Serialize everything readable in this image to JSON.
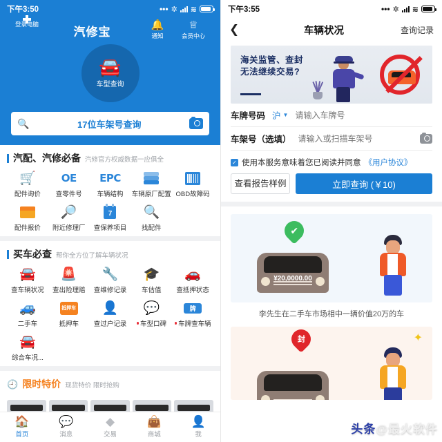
{
  "left": {
    "status": {
      "time": "下午3:50"
    },
    "hero": {
      "scan_label": "登录电脑",
      "app_title": "汽修宝",
      "notify_label": "通知",
      "member_label": "会员中心",
      "circle_label": "车型查询",
      "search_text": "17位车架号查询",
      "search_icon": "search-icon",
      "camera_icon": "camera-icon"
    },
    "section_parts": {
      "title": "汽配、汽修必备",
      "subtitle": "汽修官方权威数据一应俱全",
      "items": [
        {
          "label": "配件询价",
          "icon": "cart-icon"
        },
        {
          "label": "查零件号",
          "icon": "oe-text-icon"
        },
        {
          "label": "车辆结构",
          "icon": "epc-text-icon"
        },
        {
          "label": "车辆原厂配置",
          "icon": "layers-icon"
        },
        {
          "label": "OBD故障码",
          "icon": "barcode-icon"
        },
        {
          "label": "配件报价",
          "icon": "shop-icon"
        },
        {
          "label": "附近修理厂",
          "icon": "location-search-icon"
        },
        {
          "label": "查保养项目",
          "icon": "calendar-icon"
        },
        {
          "label": "找配件",
          "icon": "magnifier-icon"
        }
      ]
    },
    "section_buy": {
      "title": "买车必查",
      "subtitle": "帮你全方位了解车辆状况",
      "items": [
        {
          "label": "查车辆状况",
          "icon": "car-icon",
          "dot": false
        },
        {
          "label": "查出险理赔",
          "icon": "siren-icon",
          "dot": false
        },
        {
          "label": "查维修记录",
          "icon": "repair-icon",
          "dot": false
        },
        {
          "label": "车估值",
          "icon": "valuation-icon",
          "dot": false
        },
        {
          "label": "查抵押状态",
          "icon": "mortgage-car-icon",
          "dot": false
        },
        {
          "label": "二手车",
          "icon": "used-car-icon",
          "dot": false
        },
        {
          "label": "抵押车",
          "icon": "mortgage-card-icon",
          "dot": false
        },
        {
          "label": "查过户记录",
          "icon": "transfer-icon",
          "dot": false
        },
        {
          "label": "车型口碑",
          "icon": "comment-icon",
          "dot": true
        },
        {
          "label": "车牌查车辆",
          "icon": "plate-icon",
          "dot": true
        },
        {
          "label": "综合车况...",
          "icon": "car-overview-icon",
          "dot": false
        }
      ]
    },
    "section_deal": {
      "title": "限时特价",
      "subtitle": "现货特价 限时抢购",
      "clock_icon": "clock-icon"
    },
    "tabbar": [
      {
        "label": "首页",
        "icon": "home-icon",
        "active": true
      },
      {
        "label": "消息",
        "icon": "message-icon",
        "active": false
      },
      {
        "label": "交易",
        "icon": "trade-icon",
        "active": false
      },
      {
        "label": "商城",
        "icon": "shop-bag-icon",
        "active": false
      },
      {
        "label": "我",
        "icon": "profile-icon",
        "active": false
      }
    ]
  },
  "right": {
    "status": {
      "time": "下午3:55"
    },
    "nav": {
      "back_icon": "back-chevron-icon",
      "title": "车辆状况",
      "action": "查询记录"
    },
    "banner": {
      "line1": "海关监管、查封",
      "line2": "无法继续交易?"
    },
    "form": {
      "plate_label": "车牌号码",
      "plate_province": "沪",
      "plate_placeholder": "请输入车牌号",
      "vin_label": "车架号（选填）",
      "vin_placeholder": "请输入或扫描车架号",
      "camera_icon": "camera-icon"
    },
    "agreement": {
      "checked_icon": "checkbox-checked-icon",
      "text": "使用本服务意味着您已阅读并同意",
      "link": "《用户协议》"
    },
    "buttons": {
      "sample": "查看报告样例",
      "query": "立即查询 (￥10)"
    },
    "cards": [
      {
        "caption": "李先生在二手车市场相中一辆价值20万的车",
        "price_text": "¥20,0000.00",
        "badge": "✔",
        "badge_type": "check-pin"
      },
      {
        "caption": "",
        "price_text": "",
        "badge": "封",
        "badge_type": "seal-pin"
      }
    ],
    "watermark": {
      "prefix": "头条",
      "text": "@最火软件"
    }
  },
  "colors": {
    "brand_blue": "#1b7fd4",
    "icon_blue": "#2b86d9",
    "orange": "#f58220",
    "red_dot": "#e8323c",
    "green": "#3cbc5f"
  }
}
